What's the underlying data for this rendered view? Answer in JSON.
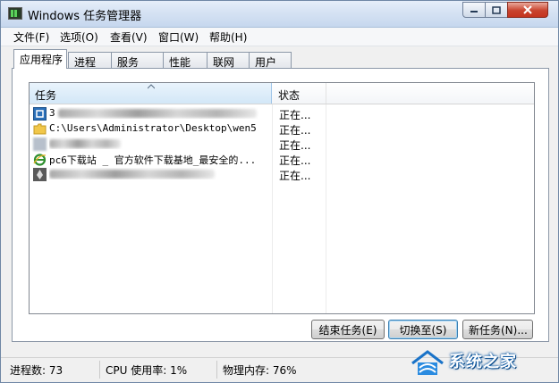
{
  "window": {
    "title": "Windows 任务管理器",
    "icon": "task-manager-app-icon",
    "controls": {
      "minimize": "minimize-icon",
      "maximize": "maximize-icon",
      "close": "close-icon"
    }
  },
  "menu": [
    "文件(F)",
    "选项(O)",
    "查看(V)",
    "窗口(W)",
    "帮助(H)"
  ],
  "tabs": [
    "应用程序",
    "进程",
    "服务",
    "性能",
    "联网",
    "用户"
  ],
  "active_tab": "应用程序",
  "task_list": {
    "columns": [
      "任务",
      "状态"
    ],
    "sort_indicator": "sort-up-icon",
    "rows": [
      {
        "icon": "app-blue-icon",
        "name": "3",
        "status": "正在..."
      },
      {
        "icon": "folder-icon",
        "name": "C:\\Users\\Administrator\\Desktop\\wen5",
        "status": "正在..."
      },
      {
        "icon": "blurred-app-icon",
        "name": "",
        "status": "正在..."
      },
      {
        "icon": "ie-browser-icon",
        "name": "pc6下载站 _ 官方软件下载基地_最安全的...",
        "status": "正在..."
      },
      {
        "icon": "pen-tool-icon",
        "name": "",
        "status": "正在..."
      }
    ]
  },
  "buttons": {
    "end_task": "结束任务(E)",
    "switch_to": "切换至(S)",
    "new_task": "新任务(N)..."
  },
  "status_bar": {
    "processes": "进程数: 73",
    "cpu": "CPU 使用率: 1%",
    "memory": "物理内存: 76%"
  },
  "watermark": {
    "text": "系统之家",
    "icon": "house-logo-icon"
  },
  "colors": {
    "title_bar": "#d5e2f3",
    "close_button": "#c9432e",
    "selected_header": "#d3e7f7",
    "window_bg": "#f0f0f0"
  }
}
